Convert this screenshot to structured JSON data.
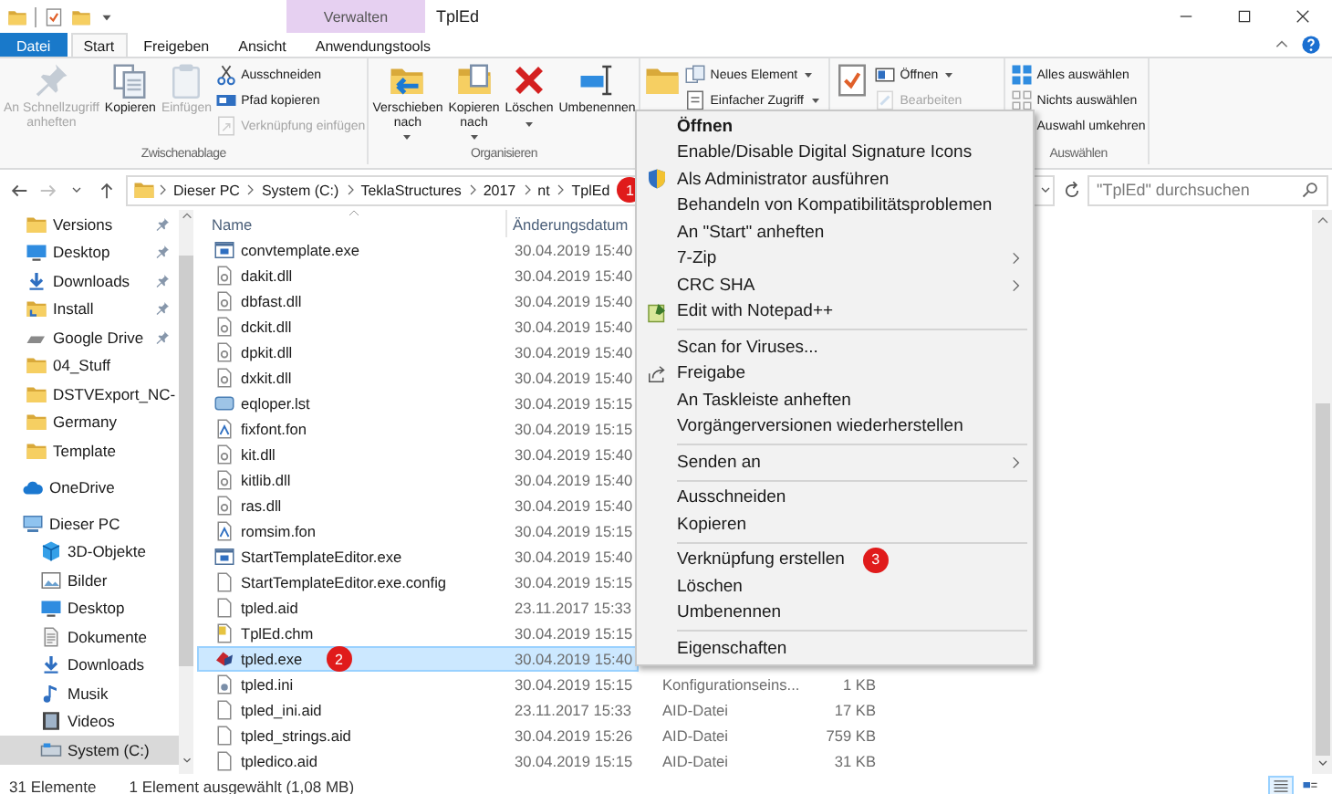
{
  "title_bar": {
    "context_tab": "Verwalten",
    "title": "TplEd"
  },
  "ribbon_tabs": [
    {
      "label": "Datei",
      "kind": "file",
      "selected": false
    },
    {
      "label": "Start",
      "kind": "tab",
      "selected": true
    },
    {
      "label": "Freigeben",
      "kind": "tab",
      "selected": false
    },
    {
      "label": "Ansicht",
      "kind": "tab",
      "selected": false
    },
    {
      "label": "Anwendungstools",
      "kind": "tab",
      "selected": false
    }
  ],
  "ribbon_groups": [
    {
      "label": "Zwischenablage",
      "large": [
        {
          "label": "An Schnellzugriff\nanheften",
          "disabled": true,
          "dropdown": false
        },
        {
          "label": "Kopieren",
          "disabled": false,
          "dropdown": false
        },
        {
          "label": "Einfügen",
          "disabled": true,
          "dropdown": false
        }
      ],
      "small": [
        {
          "label": "Ausschneiden",
          "disabled": false,
          "dropdown": false
        },
        {
          "label": "Pfad kopieren",
          "disabled": false,
          "dropdown": false
        },
        {
          "label": "Verknüpfung einfügen",
          "disabled": true,
          "dropdown": false
        }
      ]
    },
    {
      "label": "Organisieren",
      "large": [
        {
          "label": "Verschieben\nnach",
          "disabled": false,
          "dropdown": true
        },
        {
          "label": "Kopieren\nnach",
          "disabled": false,
          "dropdown": true
        },
        {
          "label": "Löschen",
          "disabled": false,
          "dropdown": true
        },
        {
          "label": "Umbenennen",
          "disabled": false,
          "dropdown": false
        }
      ]
    },
    {
      "large": [
        {
          "disabled": false,
          "dropdown": false
        }
      ],
      "small": [
        {
          "label": "Neues Element",
          "disabled": false,
          "dropdown": true
        },
        {
          "label": "Einfacher Zugriff",
          "disabled": false,
          "dropdown": true
        }
      ]
    },
    {
      "large": [
        {
          "disabled": false,
          "dropdown": false
        }
      ],
      "small": [
        {
          "label": "Öffnen",
          "disabled": false,
          "dropdown": true
        },
        {
          "label": "Bearbeiten",
          "disabled": true,
          "dropdown": false
        }
      ]
    },
    {
      "label": "Auswählen",
      "small": [
        {
          "label": "Alles auswählen",
          "disabled": false,
          "dropdown": false
        },
        {
          "label": "Nichts auswählen",
          "disabled": false,
          "dropdown": false
        },
        {
          "label": "Auswahl umkehren",
          "disabled": false,
          "dropdown": false
        }
      ]
    }
  ],
  "address_bar": {
    "crumbs": [
      "Dieser PC",
      "System (C:)",
      "TeklaStructures",
      "2017",
      "nt",
      "TplEd"
    ],
    "badge": "1",
    "search": {
      "placeholder": "\"TplEd\" durchsuchen"
    }
  },
  "nav_pane": {
    "quick_access": [
      {
        "label": "Versions",
        "kind": "folder",
        "pinned": true,
        "selected": false
      },
      {
        "label": "Desktop",
        "kind": "desktop",
        "pinned": true,
        "selected": false
      },
      {
        "label": "Downloads",
        "kind": "download",
        "pinned": true,
        "selected": false
      },
      {
        "label": "Install",
        "kind": "install",
        "pinned": true,
        "selected": false
      },
      {
        "label": "Google Drive",
        "kind": "drive",
        "pinned": true,
        "selected": false
      },
      {
        "label": "04_Stuff",
        "kind": "folder",
        "pinned": false,
        "selected": false
      },
      {
        "label": "DSTVExport_NC-",
        "kind": "folder",
        "pinned": false,
        "selected": false
      },
      {
        "label": "Germany",
        "kind": "folder",
        "pinned": false,
        "selected": false
      },
      {
        "label": "Template",
        "kind": "folder",
        "pinned": false,
        "selected": false
      }
    ],
    "locations": [
      {
        "label": "OneDrive",
        "kind": "cloud",
        "selected": false
      },
      {
        "label": "Dieser PC",
        "kind": "pc",
        "selected": false,
        "children": [
          {
            "label": "3D-Objekte",
            "kind": "cube",
            "selected": false
          },
          {
            "label": "Bilder",
            "kind": "pictures",
            "selected": false
          },
          {
            "label": "Desktop",
            "kind": "desktop",
            "selected": false
          },
          {
            "label": "Dokumente",
            "kind": "documents",
            "selected": false
          },
          {
            "label": "Downloads",
            "kind": "download",
            "selected": false
          },
          {
            "label": "Musik",
            "kind": "music",
            "selected": false
          },
          {
            "label": "Videos",
            "kind": "video",
            "selected": false
          },
          {
            "label": "System (C:)",
            "kind": "disk",
            "selected": true
          }
        ]
      }
    ]
  },
  "files": {
    "columns": [
      "Name",
      "Änderungsdatum"
    ],
    "rows": [
      {
        "name": "convtemplate.exe",
        "kind": "exe",
        "date": "30.04.2019 15:40",
        "selected": false
      },
      {
        "name": "dakit.dll",
        "kind": "dll",
        "date": "30.04.2019 15:40",
        "selected": false
      },
      {
        "name": "dbfast.dll",
        "kind": "dll",
        "date": "30.04.2019 15:40",
        "selected": false
      },
      {
        "name": "dckit.dll",
        "kind": "dll",
        "date": "30.04.2019 15:40",
        "selected": false
      },
      {
        "name": "dpkit.dll",
        "kind": "dll",
        "date": "30.04.2019 15:40",
        "selected": false
      },
      {
        "name": "dxkit.dll",
        "kind": "dll",
        "date": "30.04.2019 15:40",
        "selected": false
      },
      {
        "name": "eqloper.lst",
        "kind": "list",
        "date": "30.04.2019 15:15",
        "selected": false
      },
      {
        "name": "fixfont.fon",
        "kind": "font",
        "date": "30.04.2019 15:15",
        "selected": false
      },
      {
        "name": "kit.dll",
        "kind": "dll",
        "date": "30.04.2019 15:40",
        "selected": false
      },
      {
        "name": "kitlib.dll",
        "kind": "dll",
        "date": "30.04.2019 15:40",
        "selected": false
      },
      {
        "name": "ras.dll",
        "kind": "dll",
        "date": "30.04.2019 15:40",
        "selected": false
      },
      {
        "name": "romsim.fon",
        "kind": "font",
        "date": "30.04.2019 15:15",
        "selected": false
      },
      {
        "name": "StartTemplateEditor.exe",
        "kind": "exe",
        "date": "30.04.2019 15:40",
        "selected": false
      },
      {
        "name": "StartTemplateEditor.exe.config",
        "kind": "plain",
        "date": "30.04.2019 15:15",
        "selected": false
      },
      {
        "name": "tpled.aid",
        "kind": "plain",
        "date": "23.11.2017 15:33",
        "selected": false
      },
      {
        "name": "TplEd.chm",
        "kind": "help",
        "date": "30.04.2019 15:15",
        "selected": false
      },
      {
        "name": "tpled.exe",
        "kind": "app",
        "date": "30.04.2019 15:40",
        "selected": true,
        "badge": "2"
      },
      {
        "name": "tpled.ini",
        "kind": "ini",
        "date": "30.04.2019 15:15",
        "type": "Konfigurationseins...",
        "size": "1 KB",
        "selected": false
      },
      {
        "name": "tpled_ini.aid",
        "kind": "plain",
        "date": "23.11.2017 15:33",
        "type": "AID-Datei",
        "size": "17 KB",
        "selected": false
      },
      {
        "name": "tpled_strings.aid",
        "kind": "plain",
        "date": "30.04.2019 15:26",
        "type": "AID-Datei",
        "size": "759 KB",
        "selected": false
      },
      {
        "name": "tpledico.aid",
        "kind": "plain",
        "date": "30.04.2019 15:15",
        "type": "AID-Datei",
        "size": "31 KB",
        "selected": false
      }
    ]
  },
  "context_menu": {
    "items": [
      {
        "kind": "item",
        "label": "Öffnen",
        "default": true,
        "submenu": false
      },
      {
        "kind": "item",
        "label": "Enable/Disable Digital Signature Icons",
        "default": false,
        "submenu": false
      },
      {
        "kind": "shield",
        "label": "Als Administrator ausführen",
        "default": false,
        "submenu": false
      },
      {
        "kind": "item",
        "label": "Behandeln von Kompatibilitätsproblemen",
        "default": false,
        "submenu": false
      },
      {
        "kind": "item",
        "label": "An \"Start\" anheften",
        "default": false,
        "submenu": false
      },
      {
        "kind": "item",
        "label": "7-Zip",
        "default": false,
        "submenu": true
      },
      {
        "kind": "item",
        "label": "CRC SHA",
        "default": false,
        "submenu": true
      },
      {
        "kind": "notepad",
        "label": "Edit with Notepad++",
        "default": false,
        "submenu": false
      },
      {
        "kind": "separator"
      },
      {
        "kind": "item",
        "label": "Scan for Viruses...",
        "default": false,
        "submenu": false
      },
      {
        "kind": "share",
        "label": "Freigabe",
        "default": false,
        "submenu": false
      },
      {
        "kind": "item",
        "label": "An Taskleiste anheften",
        "default": false,
        "submenu": false
      },
      {
        "kind": "item",
        "label": "Vorgängerversionen wiederherstellen",
        "default": false,
        "submenu": false
      },
      {
        "kind": "separator"
      },
      {
        "kind": "item",
        "label": "Senden an",
        "default": false,
        "submenu": true
      },
      {
        "kind": "separator"
      },
      {
        "kind": "item",
        "label": "Ausschneiden",
        "default": false,
        "submenu": false
      },
      {
        "kind": "item",
        "label": "Kopieren",
        "default": false,
        "submenu": false
      },
      {
        "kind": "separator"
      },
      {
        "kind": "item",
        "label": "Verknüpfung erstellen",
        "default": false,
        "submenu": false,
        "badge": "3"
      },
      {
        "kind": "item",
        "label": "Löschen",
        "default": false,
        "submenu": false
      },
      {
        "kind": "item",
        "label": "Umbenennen",
        "default": false,
        "submenu": false
      },
      {
        "kind": "separator"
      },
      {
        "kind": "item",
        "label": "Eigenschaften",
        "default": false,
        "submenu": false
      }
    ]
  },
  "status_bar": {
    "count": "31 Elemente",
    "selection": "1 Element ausgewählt (1,08 MB)",
    "views": [
      {
        "kind": "details",
        "selected": true
      },
      {
        "kind": "tiles",
        "selected": false
      }
    ]
  }
}
